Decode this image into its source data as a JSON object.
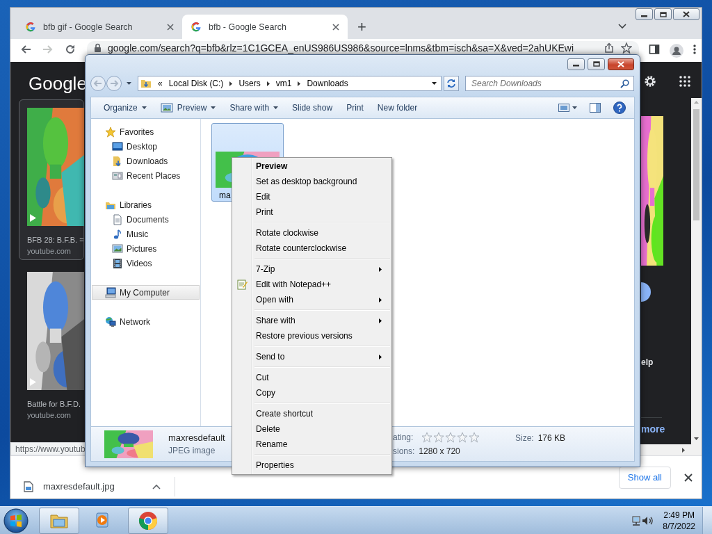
{
  "browser": {
    "tabs": [
      {
        "title": "bfb gif - Google Search",
        "selected": false
      },
      {
        "title": "bfb - Google Search",
        "selected": true
      }
    ],
    "new_tab": "+",
    "nav_buttons": [
      {
        "kind": "back",
        "disabled": false
      },
      {
        "kind": "forward",
        "disabled": true
      },
      {
        "kind": "reload",
        "disabled": false
      }
    ],
    "url": "google.com/search?q=bfb&rlz=1C1GCEA_enUS986US986&source=lnms&tbm=isch&sa=X&ved=2ahUKEwi",
    "logo": "Google",
    "results": [
      {
        "caption": "BFB 28: B.F.B. =",
        "source": "youtube.com",
        "selected": true
      },
      {
        "caption": "Battle for B.F.D.",
        "source": "youtube.com",
        "selected": false
      }
    ],
    "right_texts": [
      {
        "kind": "text",
        "label": "elp"
      },
      {
        "kind": "link",
        "label": "more"
      }
    ],
    "status_url": "https://www.youtub",
    "download": {
      "file": "maxresdefault.jpg",
      "show_all": "Show all"
    }
  },
  "explorer": {
    "nav_buttons": [
      {
        "kind": "back",
        "disabled": true
      },
      {
        "kind": "forward",
        "disabled": true
      }
    ],
    "overflow": "«",
    "breadcrumb": [
      "Local Disk (C:)",
      "Users",
      "vm1",
      "Downloads"
    ],
    "search_placeholder": "Search Downloads",
    "toolbar": [
      {
        "label": "Organize",
        "dropdown": true
      },
      {
        "label": "Preview",
        "dropdown": true
      },
      {
        "label": "Share with",
        "dropdown": true
      },
      {
        "label": "Slide show",
        "dropdown": false
      },
      {
        "label": "Print",
        "dropdown": false
      },
      {
        "label": "New folder",
        "dropdown": false
      }
    ],
    "nav": [
      {
        "label": "Favorites",
        "selected": false,
        "children": [
          {
            "label": "Desktop",
            "selected": false
          },
          {
            "label": "Downloads",
            "selected": false
          },
          {
            "label": "Recent Places",
            "selected": false
          }
        ]
      },
      {
        "label": "Libraries",
        "selected": false,
        "children": [
          {
            "label": "Documents",
            "selected": false
          },
          {
            "label": "Music",
            "selected": false
          },
          {
            "label": "Pictures",
            "selected": false
          },
          {
            "label": "Videos",
            "selected": false
          }
        ]
      },
      {
        "label": "My Computer",
        "selected": true
      },
      {
        "label": "Network",
        "selected": false
      }
    ],
    "files": [
      {
        "label": "ma",
        "selected": true
      }
    ],
    "details": {
      "name": "maxresdefault",
      "type": "JPEG image",
      "rating_label": "ating:",
      "stars": 0,
      "dimensions_label": "sions:",
      "dimensions": "1280 x 720",
      "size_label": "Size:",
      "size": "176 KB"
    }
  },
  "context_menu": {
    "groups": [
      [
        {
          "label": "Preview",
          "default": true,
          "submenu": false,
          "kind": "plain"
        },
        {
          "label": "Set as desktop background",
          "default": false,
          "submenu": false,
          "kind": "plain"
        },
        {
          "label": "Edit",
          "default": false,
          "submenu": false,
          "kind": "plain"
        },
        {
          "label": "Print",
          "default": false,
          "submenu": false,
          "kind": "plain"
        }
      ],
      [
        {
          "label": "Rotate clockwise",
          "default": false,
          "submenu": false,
          "kind": "plain"
        },
        {
          "label": "Rotate counterclockwise",
          "default": false,
          "submenu": false,
          "kind": "plain"
        }
      ],
      [
        {
          "label": "7-Zip",
          "default": false,
          "submenu": true,
          "kind": "plain"
        },
        {
          "label": "Edit with Notepad++",
          "default": false,
          "submenu": false,
          "kind": "app"
        },
        {
          "label": "Open with",
          "default": false,
          "submenu": true,
          "kind": "plain"
        }
      ],
      [
        {
          "label": "Share with",
          "default": false,
          "submenu": true,
          "kind": "plain"
        },
        {
          "label": "Restore previous versions",
          "default": false,
          "submenu": false,
          "kind": "plain"
        }
      ],
      [
        {
          "label": "Send to",
          "default": false,
          "submenu": true,
          "kind": "plain"
        }
      ],
      [
        {
          "label": "Cut",
          "default": false,
          "submenu": false,
          "kind": "plain"
        },
        {
          "label": "Copy",
          "default": false,
          "submenu": false,
          "kind": "plain"
        }
      ],
      [
        {
          "label": "Create shortcut",
          "default": false,
          "submenu": false,
          "kind": "plain"
        },
        {
          "label": "Delete",
          "default": false,
          "submenu": false,
          "kind": "plain"
        },
        {
          "label": "Rename",
          "default": false,
          "submenu": false,
          "kind": "plain"
        }
      ],
      [
        {
          "label": "Properties",
          "default": false,
          "submenu": false,
          "kind": "plain"
        }
      ]
    ]
  },
  "taskbar": {
    "apps": [
      {
        "kind": "explorer",
        "running": true
      },
      {
        "kind": "media",
        "running": false
      },
      {
        "kind": "chrome",
        "running": true
      }
    ],
    "time": "2:49 PM",
    "date": "8/7/2022"
  }
}
